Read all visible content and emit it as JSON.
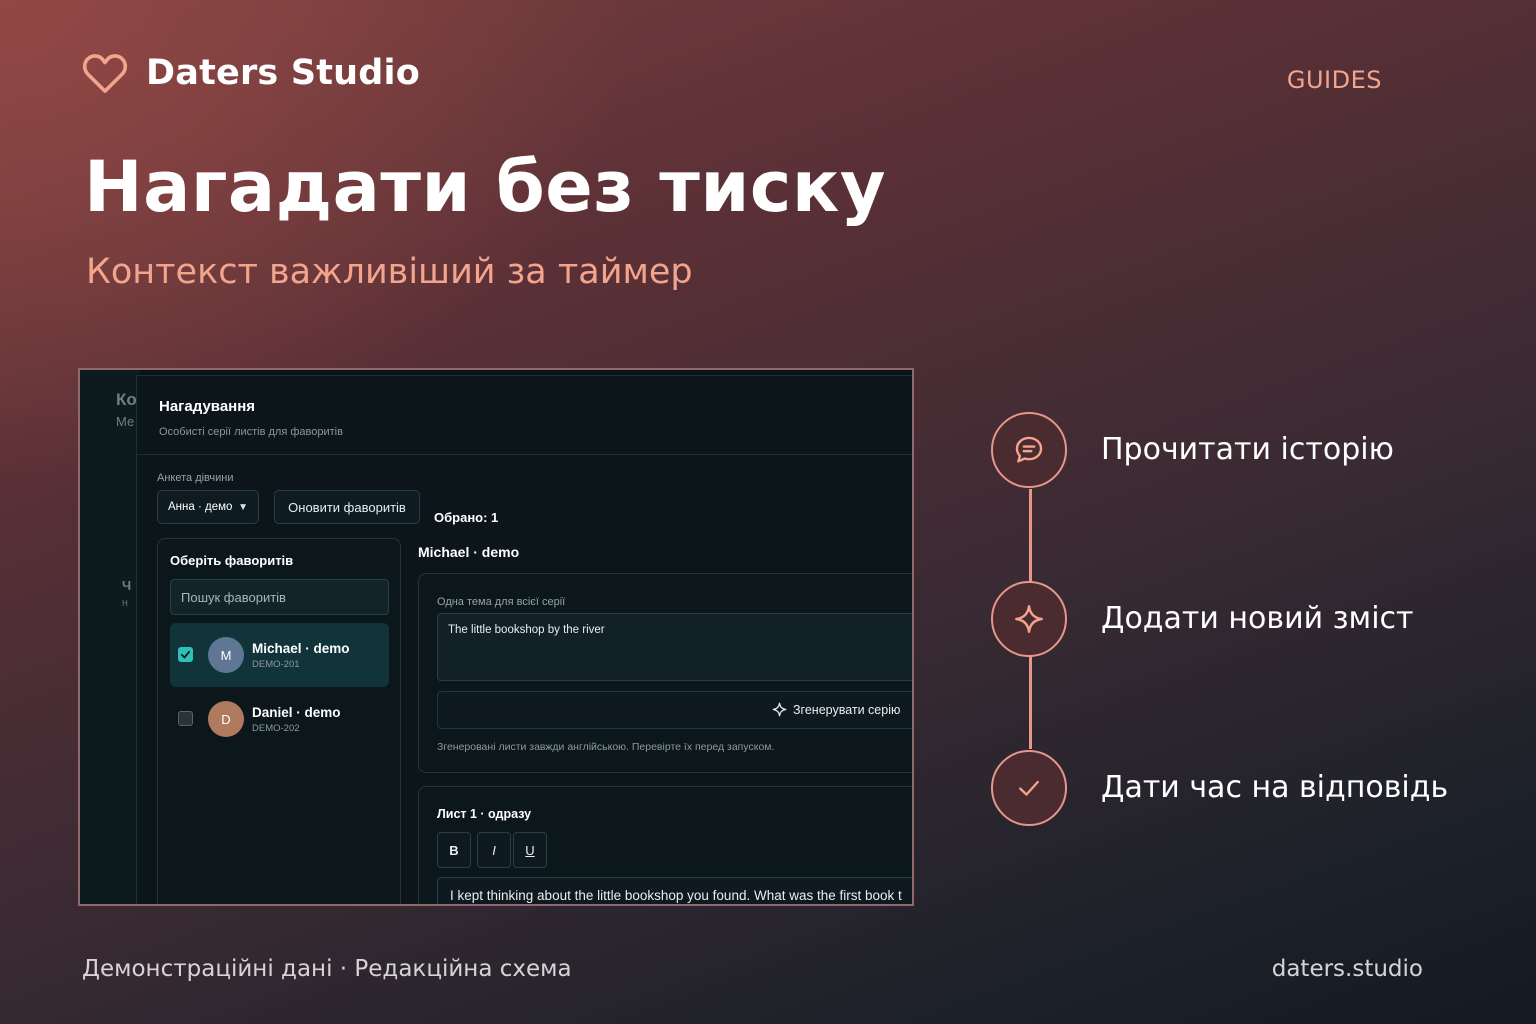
{
  "brand": {
    "name": "Daters Studio",
    "icon": "heart-icon"
  },
  "nav": {
    "guides": "GUIDES"
  },
  "hero": {
    "title": "Нагадати без тиску",
    "subtitle": "Контекст важливіший за таймер"
  },
  "app": {
    "background_fragments": {
      "a": "Ко",
      "b": "Ме",
      "c": "Ч",
      "d": "Н"
    },
    "panel_title": "Нагадування",
    "panel_subtitle": "Особисті серії листів для фаворитів",
    "profile_label": "Анкета дівчини",
    "profile_select": "Анна · демо",
    "refresh_button": "Оновити фаворитів",
    "favorites_heading": "Оберіть фаворитів",
    "search_placeholder": "Пошук фаворитів",
    "favorites": [
      {
        "initial": "M",
        "name": "Michael · demo",
        "id": "DEMO-201",
        "checked": true,
        "avatar_color": "#5f7795"
      },
      {
        "initial": "D",
        "name": "Daniel · demo",
        "id": "DEMO-202",
        "checked": false,
        "avatar_color": "#b07a5e"
      }
    ],
    "selected_count": "Обрано: 1",
    "selected_name": "Michael · demo",
    "theme_label": "Одна тема для всієї серії",
    "theme_value": "The little bookshop by the river",
    "generate_button": "Згенерувати серію",
    "generate_note": "Згенеровані листи завжди англійською. Перевірте їх перед запуском.",
    "letter": {
      "title": "Лист 1 · одразу",
      "bold": "B",
      "italic": "I",
      "underline": "U",
      "body": "I kept thinking about the little bookshop you found. What was the first book t"
    }
  },
  "steps": [
    {
      "icon": "chat-bubble-icon",
      "label": "Прочитати історію"
    },
    {
      "icon": "sparkle-icon",
      "label": "Додати новий зміст"
    },
    {
      "icon": "check-icon",
      "label": "Дати час на відповідь"
    }
  ],
  "footer": {
    "left": "Демонстраційні дані · Редакційна схема",
    "right": "daters.studio"
  },
  "colors": {
    "accent": "#f2a48c",
    "rail": "#e6968a",
    "checkbox": "#2ec1b7"
  }
}
